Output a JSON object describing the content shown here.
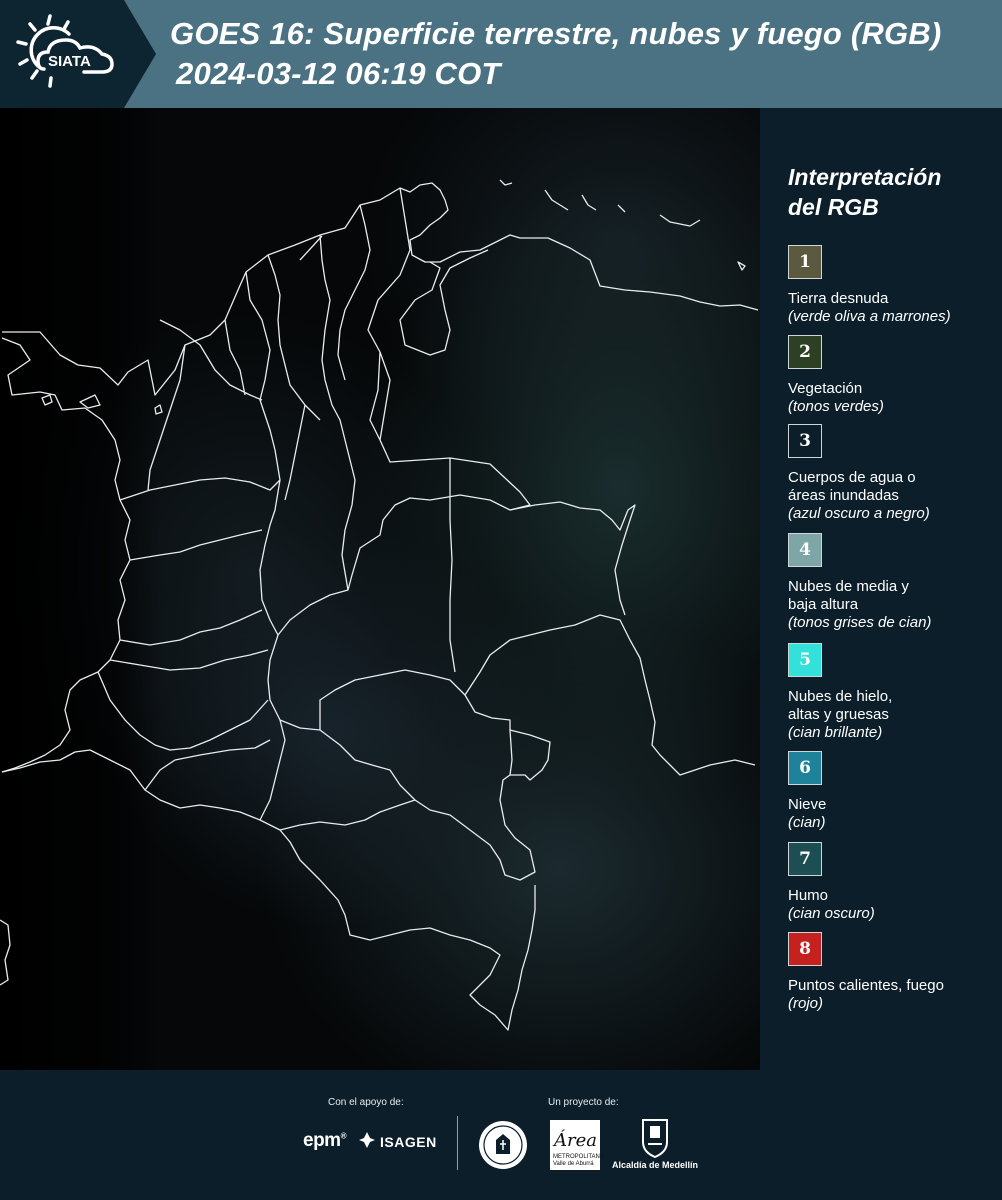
{
  "header": {
    "logo_text": "SIATA",
    "title_line1": "GOES 16: Superficie terrestre, nubes y fuego (RGB)",
    "title_line2": "2024-03-12 06:19 COT"
  },
  "legend": {
    "title_line1": "Interpretación",
    "title_line2": "del RGB",
    "items": [
      {
        "number": "1",
        "color": "#5b5a3e",
        "label": "Tierra desnuda",
        "desc": "(verde oliva a marrones)"
      },
      {
        "number": "2",
        "color": "#2d4024",
        "label": "Vegetación",
        "desc": "(tonos verdes)"
      },
      {
        "number": "3",
        "color": "#0b1e29",
        "label": "Cuerpos de agua o áreas inundadas",
        "desc": "(azul oscuro a negro)"
      },
      {
        "number": "4",
        "color": "#7fa6a7",
        "label": "Nubes de media y baja altura",
        "desc": "(tonos grises de cian)"
      },
      {
        "number": "5",
        "color": "#33e0da",
        "label": "Nubes de hielo, altas y gruesas",
        "desc": "(cian brillante)"
      },
      {
        "number": "6",
        "color": "#1e839a",
        "label": "Nieve",
        "desc": "(cian)"
      },
      {
        "number": "7",
        "color": "#1c4e54",
        "label": "Humo",
        "desc": "(cian oscuro)"
      },
      {
        "number": "8",
        "color": "#c4211f",
        "label": "Puntos calientes, fuego",
        "desc": "(rojo)"
      }
    ]
  },
  "footer": {
    "support_label": "Con el apoyo de:",
    "project_label": "Un proyecto de:",
    "epm": "epm",
    "isagen": "ISAGEN",
    "amva": "Área",
    "amva_sub": "METROPOLITANA Valle de Aburrá",
    "alcaldia": "Alcaldía de Medellín"
  }
}
